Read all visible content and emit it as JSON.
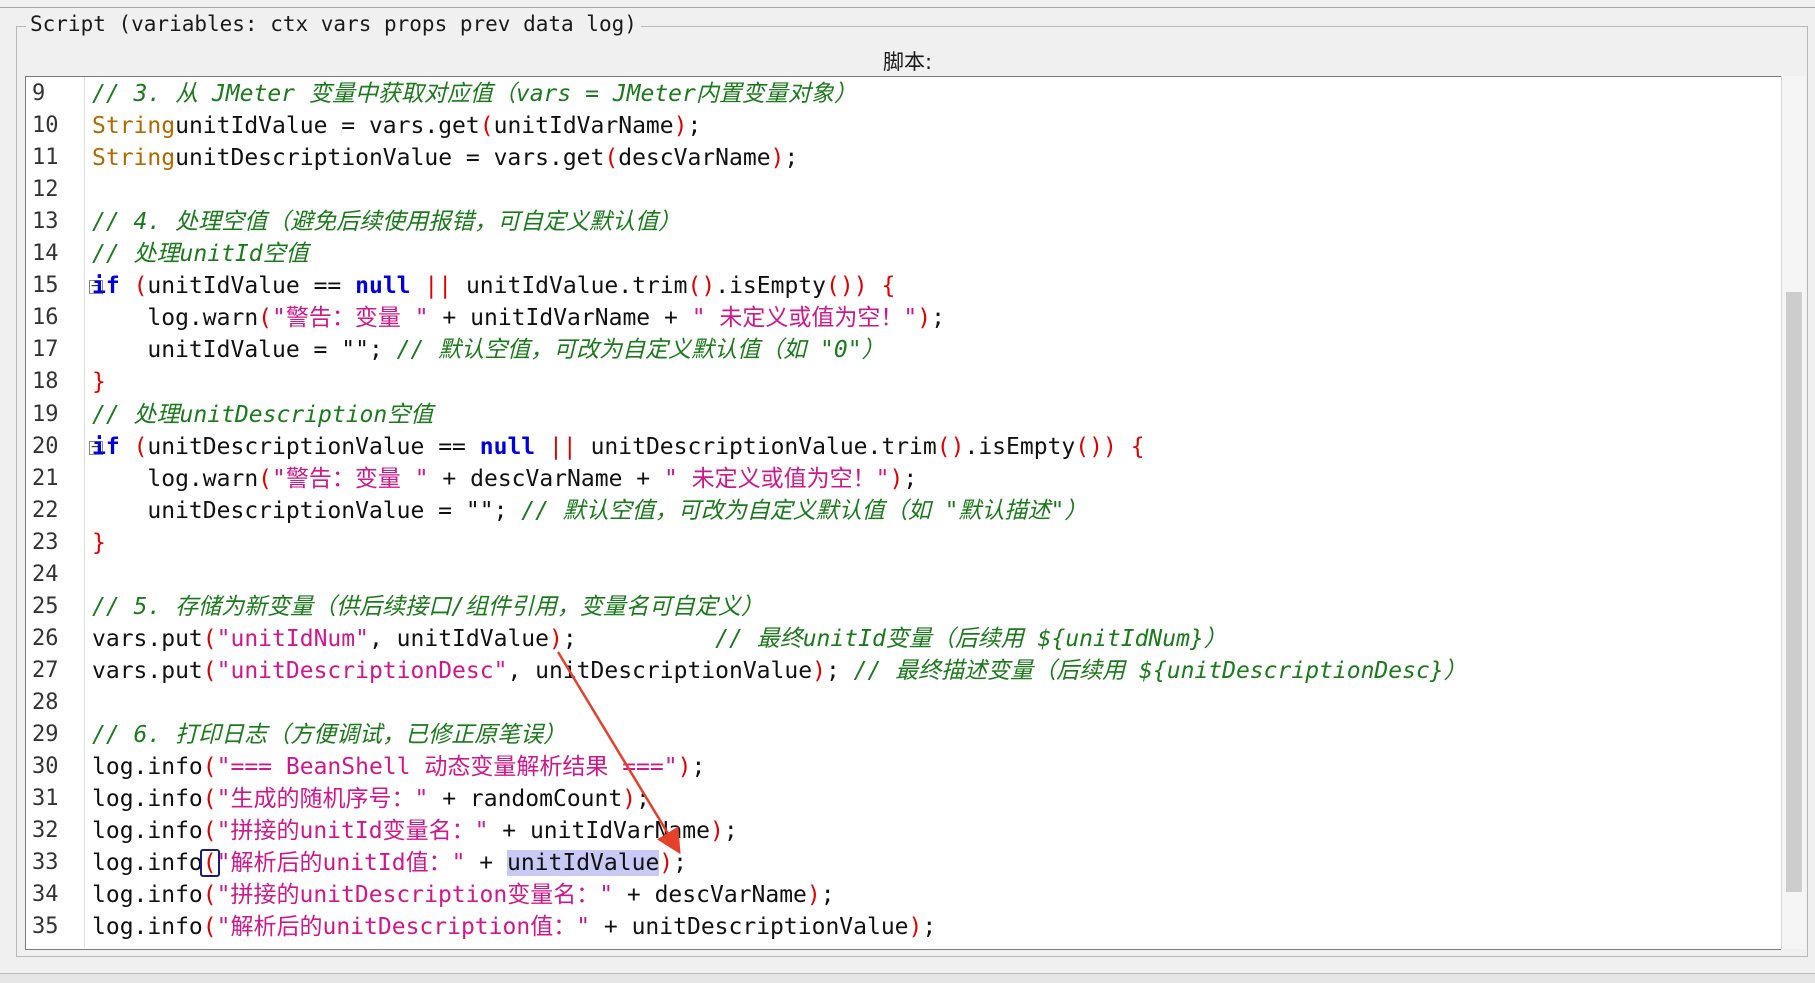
{
  "panel": {
    "legend": "Script (variables: ctx vars props prev data log)",
    "editor_label": "脚本:"
  },
  "colors": {
    "comment": "#1b7a1b",
    "keyword": "#0000e0",
    "type": "#b06a00",
    "string": "#d0178c",
    "bracket": "#e00000",
    "selection": "#c9c9f5",
    "annotation_arrow": "#e4402a"
  },
  "editor": {
    "lines": [
      {
        "n": "9",
        "t": [
          [
            "cm",
            "// 3. 从 JMeter 变量中获取对应值（vars = JMeter内置变量对象）"
          ]
        ]
      },
      {
        "n": "10",
        "t": [
          [
            "ty",
            "String"
          ],
          [
            "",
            "unitIdValue = vars.get"
          ],
          [
            "br",
            "("
          ],
          [
            "",
            "unitIdVarName"
          ],
          [
            "br",
            ")"
          ],
          [
            "",
            ";"
          ]
        ]
      },
      {
        "n": "11",
        "t": [
          [
            "ty",
            "String"
          ],
          [
            "",
            "unitDescriptionValue = vars.get"
          ],
          [
            "br",
            "("
          ],
          [
            "",
            "descVarName"
          ],
          [
            "br",
            ")"
          ],
          [
            "",
            ";"
          ]
        ]
      },
      {
        "n": "12",
        "t": []
      },
      {
        "n": "13",
        "t": [
          [
            "cm",
            "// 4. 处理空值（避免后续使用报错，可自定义默认值）"
          ]
        ]
      },
      {
        "n": "14",
        "t": [
          [
            "cm",
            "// 处理unitId空值"
          ]
        ]
      },
      {
        "n": "15",
        "fold": true,
        "t": [
          [
            "kw",
            "if"
          ],
          [
            "",
            " "
          ],
          [
            "br",
            "("
          ],
          [
            "",
            "unitIdValue == "
          ],
          [
            "kw",
            "null"
          ],
          [
            "",
            " "
          ],
          [
            "br",
            "||"
          ],
          [
            "",
            " unitIdValue.trim"
          ],
          [
            "br",
            "("
          ],
          [
            "br",
            ")"
          ],
          [
            "",
            ".isEmpty"
          ],
          [
            "br",
            "("
          ],
          [
            "br",
            ")"
          ],
          [
            "br",
            ")"
          ],
          [
            "",
            " "
          ],
          [
            "br",
            "{"
          ]
        ]
      },
      {
        "n": "16",
        "t": [
          [
            "",
            "    log.warn"
          ],
          [
            "br",
            "("
          ],
          [
            "st",
            "\"警告：变量 \""
          ],
          [
            "",
            " + unitIdVarName + "
          ],
          [
            "st",
            "\" 未定义或值为空！\""
          ],
          [
            "br",
            ")"
          ],
          [
            "",
            ";"
          ]
        ]
      },
      {
        "n": "17",
        "t": [
          [
            "",
            "    unitIdValue = \"\"; "
          ],
          [
            "cm",
            "// 默认空值，可改为自定义默认值（如 \"0\"）"
          ]
        ]
      },
      {
        "n": "18",
        "t": [
          [
            "br",
            "}"
          ]
        ]
      },
      {
        "n": "19",
        "t": [
          [
            "cm",
            "// 处理unitDescription空值"
          ]
        ]
      },
      {
        "n": "20",
        "fold": true,
        "t": [
          [
            "kw",
            "if"
          ],
          [
            "",
            " "
          ],
          [
            "br",
            "("
          ],
          [
            "",
            "unitDescriptionValue == "
          ],
          [
            "kw",
            "null"
          ],
          [
            "",
            " "
          ],
          [
            "br",
            "||"
          ],
          [
            "",
            " unitDescriptionValue.trim"
          ],
          [
            "br",
            "("
          ],
          [
            "br",
            ")"
          ],
          [
            "",
            ".isEmpty"
          ],
          [
            "br",
            "("
          ],
          [
            "br",
            ")"
          ],
          [
            "br",
            ")"
          ],
          [
            "",
            " "
          ],
          [
            "br",
            "{"
          ]
        ]
      },
      {
        "n": "21",
        "t": [
          [
            "",
            "    log.warn"
          ],
          [
            "br",
            "("
          ],
          [
            "st",
            "\"警告：变量 \""
          ],
          [
            "",
            " + descVarName + "
          ],
          [
            "st",
            "\" 未定义或值为空！\""
          ],
          [
            "br",
            ")"
          ],
          [
            "",
            ";"
          ]
        ]
      },
      {
        "n": "22",
        "t": [
          [
            "",
            "    unitDescriptionValue = \"\"; "
          ],
          [
            "cm",
            "// 默认空值，可改为自定义默认值（如 \"默认描述\"）"
          ]
        ]
      },
      {
        "n": "23",
        "t": [
          [
            "br",
            "}"
          ]
        ]
      },
      {
        "n": "24",
        "t": []
      },
      {
        "n": "25",
        "t": [
          [
            "cm",
            "// 5. 存储为新变量（供后续接口/组件引用，变量名可自定义）"
          ]
        ]
      },
      {
        "n": "26",
        "t": [
          [
            "",
            "vars.put"
          ],
          [
            "br",
            "("
          ],
          [
            "st",
            "\"unitIdNum\""
          ],
          [
            "",
            ", unitIdValue"
          ],
          [
            "br",
            ")"
          ],
          [
            "",
            ";          "
          ],
          [
            "cm",
            "// 最终unitId变量（后续用 ${unitIdNum}）"
          ]
        ]
      },
      {
        "n": "27",
        "t": [
          [
            "",
            "vars.put"
          ],
          [
            "br",
            "("
          ],
          [
            "st",
            "\"unitDescriptionDesc\""
          ],
          [
            "",
            ", unitDescriptionValue"
          ],
          [
            "br",
            ")"
          ],
          [
            "",
            "; "
          ],
          [
            "cm",
            "// 最终描述变量（后续用 ${unitDescriptionDesc}）"
          ]
        ]
      },
      {
        "n": "28",
        "t": []
      },
      {
        "n": "29",
        "t": [
          [
            "cm",
            "// 6. 打印日志（方便调试，已修正原笔误）"
          ]
        ]
      },
      {
        "n": "30",
        "t": [
          [
            "",
            "log.info"
          ],
          [
            "br",
            "("
          ],
          [
            "st",
            "\"=== BeanShell 动态变量解析结果 ===\""
          ],
          [
            "br",
            ")"
          ],
          [
            "",
            ";"
          ]
        ]
      },
      {
        "n": "31",
        "t": [
          [
            "",
            "log.info"
          ],
          [
            "br",
            "("
          ],
          [
            "st",
            "\"生成的随机序号：\""
          ],
          [
            "",
            " + randomCount"
          ],
          [
            "br",
            ")"
          ],
          [
            "",
            ";"
          ]
        ]
      },
      {
        "n": "32",
        "t": [
          [
            "",
            "log.info"
          ],
          [
            "br",
            "("
          ],
          [
            "st",
            "\"拼接的unitId变量名：\""
          ],
          [
            "",
            " + unitIdVarName"
          ],
          [
            "br",
            ")"
          ],
          [
            "",
            ";"
          ]
        ]
      },
      {
        "n": "33",
        "t": [
          [
            "",
            "log.info"
          ],
          [
            "br caret",
            "("
          ],
          [
            "st",
            "\"解析后的unitId值：\""
          ],
          [
            "",
            " + "
          ],
          [
            "hl",
            "unitIdValue"
          ],
          [
            "br",
            ")"
          ],
          [
            "",
            ";"
          ]
        ]
      },
      {
        "n": "34",
        "t": [
          [
            "",
            "log.info"
          ],
          [
            "br",
            "("
          ],
          [
            "st",
            "\"拼接的unitDescription变量名：\""
          ],
          [
            "",
            " + descVarName"
          ],
          [
            "br",
            ")"
          ],
          [
            "",
            ";"
          ]
        ]
      },
      {
        "n": "35",
        "t": [
          [
            "",
            "log.info"
          ],
          [
            "br",
            "("
          ],
          [
            "st",
            "\"解析后的unitDescription值：\""
          ],
          [
            "",
            " + unitDescriptionValue"
          ],
          [
            "br",
            ")"
          ],
          [
            "",
            ";"
          ]
        ]
      }
    ]
  }
}
